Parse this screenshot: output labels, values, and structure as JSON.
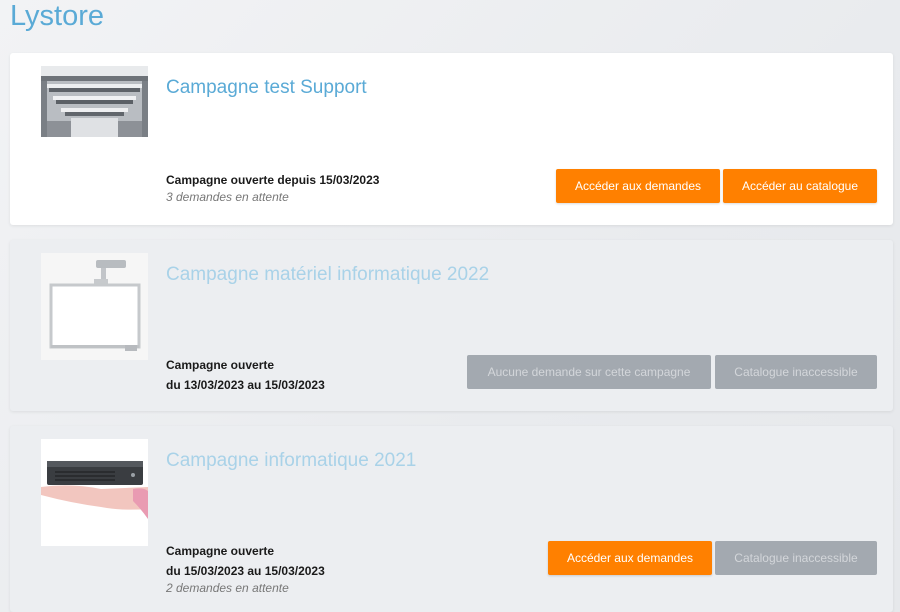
{
  "app": {
    "title": "Lystore"
  },
  "colors": {
    "accent": "#5aaad6",
    "action": "#ff8000",
    "disabled": "#a3a9b0"
  },
  "campaigns": [
    {
      "title": "Campagne test Support",
      "image": "library-interior-image",
      "status_line1": "Campagne ouverte depuis 15/03/2023",
      "pending": "3 demandes en attente",
      "btn_requests": "Accéder aux demandes",
      "btn_catalog": "Accéder au catalogue"
    },
    {
      "title": "Campagne matériel informatique 2022",
      "image": "interactive-whiteboard-image",
      "status_line1": "Campagne ouverte",
      "status_line2": "du 13/03/2023 au 15/03/2023",
      "btn_requests": "Aucune demande sur cette campagne",
      "btn_catalog": "Catalogue inaccessible"
    },
    {
      "title": "Campagne informatique 2021",
      "image": "mini-pc-on-hand-image",
      "status_line1": "Campagne ouverte",
      "status_line2": "du 15/03/2023 au 15/03/2023",
      "pending": "2 demandes en attente",
      "btn_requests": "Accéder aux demandes",
      "btn_catalog": "Catalogue inaccessible"
    }
  ]
}
